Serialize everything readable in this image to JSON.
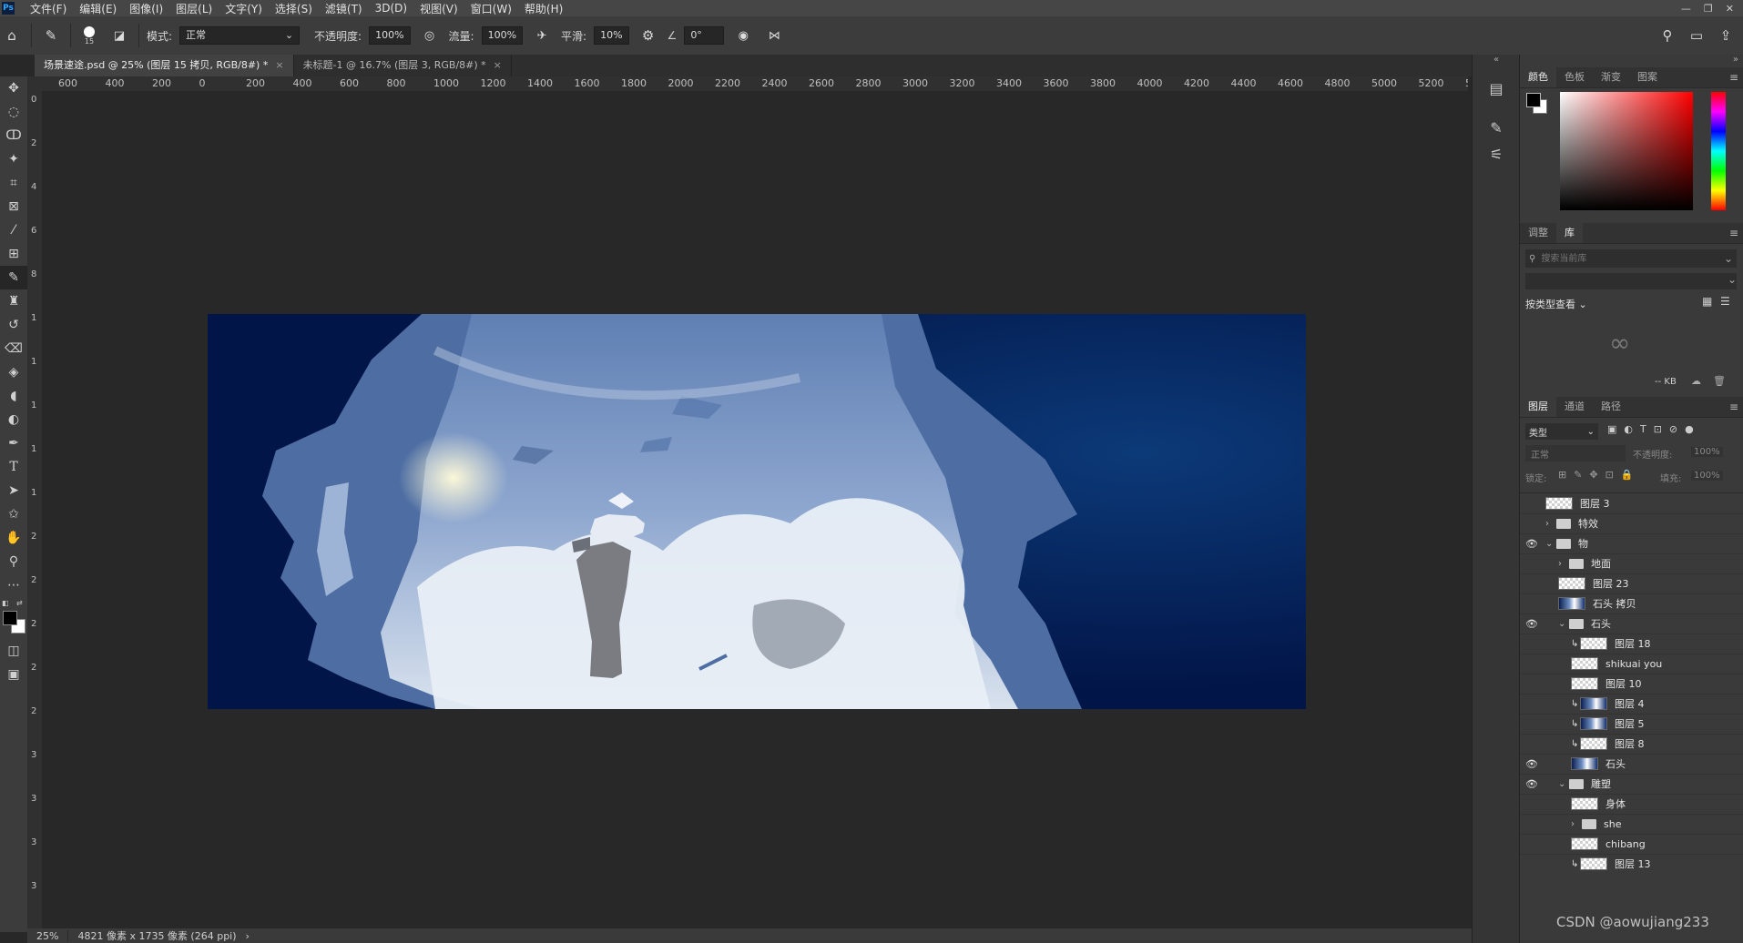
{
  "menu": {
    "logo": "Ps",
    "items": [
      "文件(F)",
      "编辑(E)",
      "图像(I)",
      "图层(L)",
      "文字(Y)",
      "选择(S)",
      "滤镜(T)",
      "3D(D)",
      "视图(V)",
      "窗口(W)",
      "帮助(H)"
    ]
  },
  "options": {
    "brush_size": "15",
    "mode_label": "模式:",
    "mode_value": "正常",
    "opacity_label": "不透明度:",
    "opacity_value": "100%",
    "flow_label": "流量:",
    "flow_value": "100%",
    "smooth_label": "平滑:",
    "smooth_value": "10%",
    "angle_value": "0°"
  },
  "tabs": [
    {
      "label": "场景速途.psd @ 25% (图层 15 拷贝, RGB/8#) *",
      "active": true
    },
    {
      "label": "未标题-1 @ 16.7% (图层 3, RGB/8#) *",
      "active": false
    }
  ],
  "ruler": {
    "h_ticks": [
      "600",
      "400",
      "200",
      "0",
      "200",
      "400",
      "600",
      "800",
      "1000",
      "1200",
      "1400",
      "1600",
      "1800",
      "2000",
      "2200",
      "2400",
      "2600",
      "2800",
      "3000",
      "3200",
      "3400",
      "3600",
      "3800",
      "4000",
      "4200",
      "4400",
      "4600",
      "4800",
      "5000",
      "5200",
      "5400"
    ],
    "v_ticks": [
      "0",
      "2",
      "4",
      "6",
      "8",
      "1",
      "1",
      "1",
      "1",
      "1",
      "2",
      "2",
      "2",
      "2",
      "2",
      "3",
      "3",
      "3",
      "3"
    ]
  },
  "status": {
    "zoom": "25%",
    "doc_info": "4821 像素 x 1735 像素 (264 ppi)"
  },
  "panels": {
    "color_tabs": [
      "颜色",
      "色板",
      "渐变",
      "图案"
    ],
    "adj_tabs": [
      "调整",
      "库"
    ],
    "lib_search_placeholder": "搜索当前库",
    "lib_view": "按类型查看",
    "lib_size": "-- KB",
    "layer_tabs": [
      "图层",
      "通道",
      "路径"
    ],
    "layer_filter": "类型",
    "blend_mode": "正常",
    "opacity_label": "不透明度:",
    "opacity_value": "100%",
    "lock_label": "锁定:",
    "fill_label": "填充:",
    "fill_value": "100%"
  },
  "layers": [
    {
      "name": "图层 3",
      "type": "layer",
      "visible": false,
      "indent": 0
    },
    {
      "name": "特效",
      "type": "group",
      "visible": false,
      "indent": 0,
      "expanded": false
    },
    {
      "name": "物",
      "type": "group",
      "visible": true,
      "indent": 0,
      "expanded": true
    },
    {
      "name": "地面",
      "type": "group",
      "visible": false,
      "indent": 1,
      "expanded": false
    },
    {
      "name": "图层 23",
      "type": "layer",
      "visible": false,
      "indent": 1
    },
    {
      "name": "石头 拷贝",
      "type": "layer",
      "visible": false,
      "indent": 1,
      "dark": true
    },
    {
      "name": "石头",
      "type": "group",
      "visible": true,
      "indent": 1,
      "expanded": true
    },
    {
      "name": "图层 18",
      "type": "layer",
      "visible": false,
      "indent": 2,
      "clip": true
    },
    {
      "name": "shikuai you",
      "type": "layer",
      "visible": false,
      "indent": 2
    },
    {
      "name": "图层 10",
      "type": "layer",
      "visible": false,
      "indent": 2
    },
    {
      "name": "图层 4",
      "type": "layer",
      "visible": false,
      "indent": 2,
      "clip": true,
      "dark": true
    },
    {
      "name": "图层 5",
      "type": "layer",
      "visible": false,
      "indent": 2,
      "clip": true,
      "dark": true
    },
    {
      "name": "图层 8",
      "type": "layer",
      "visible": false,
      "indent": 2,
      "clip": true
    },
    {
      "name": "石头",
      "type": "layer",
      "visible": true,
      "indent": 2,
      "dark": true
    },
    {
      "name": "雕塑",
      "type": "group",
      "visible": true,
      "indent": 1,
      "expanded": true
    },
    {
      "name": "身体",
      "type": "layer",
      "visible": false,
      "indent": 2
    },
    {
      "name": "she",
      "type": "group",
      "visible": false,
      "indent": 2,
      "expanded": false
    },
    {
      "name": "chibang",
      "type": "layer",
      "visible": false,
      "indent": 2
    },
    {
      "name": "图层 13",
      "type": "layer",
      "visible": false,
      "indent": 2,
      "clip": true
    }
  ],
  "watermark": "CSDN @aowujiang233",
  "colors": {
    "bg": "#282828",
    "panel": "#3a3a3a",
    "accent": "#31a8ff",
    "canvas_dark": "#04164a",
    "canvas_sky": "#6f8fbf"
  }
}
